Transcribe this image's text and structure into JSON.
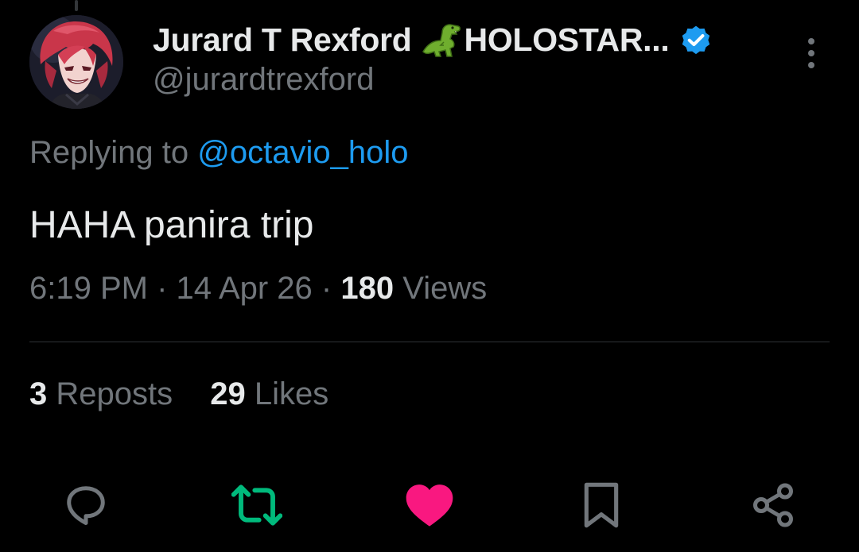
{
  "author": {
    "display_name": "Jurard T Rexford",
    "emoji_icon": "t-rex-icon",
    "name_suffix": "HOLOSTAR...",
    "verified": true,
    "verified_color": "#1d9bf0",
    "handle": "@jurardtrexford",
    "avatar_icon": "anime-avatar"
  },
  "reply": {
    "prefix": "Replying to",
    "mention": "@octavio_holo"
  },
  "tweet": {
    "text": "HAHA panira trip",
    "time": "6:19 PM",
    "separator": "·",
    "date": "14 Apr 26",
    "views_count": "180",
    "views_label": "Views"
  },
  "stats": {
    "reposts_count": "3",
    "reposts_label": "Reposts",
    "likes_count": "29",
    "likes_label": "Likes"
  },
  "actions": {
    "reply_icon": "reply-icon",
    "repost_icon": "repost-icon",
    "like_icon": "heart-icon",
    "bookmark_icon": "bookmark-icon",
    "share_icon": "share-icon",
    "more_icon": "more-vertical-icon"
  },
  "colors": {
    "background": "#000000",
    "text_primary": "#e7e9ea",
    "text_secondary": "#71767b",
    "link": "#1d9bf0",
    "repost_active": "#00ba7c",
    "like_active": "#f91880",
    "divider": "#2f3336"
  }
}
